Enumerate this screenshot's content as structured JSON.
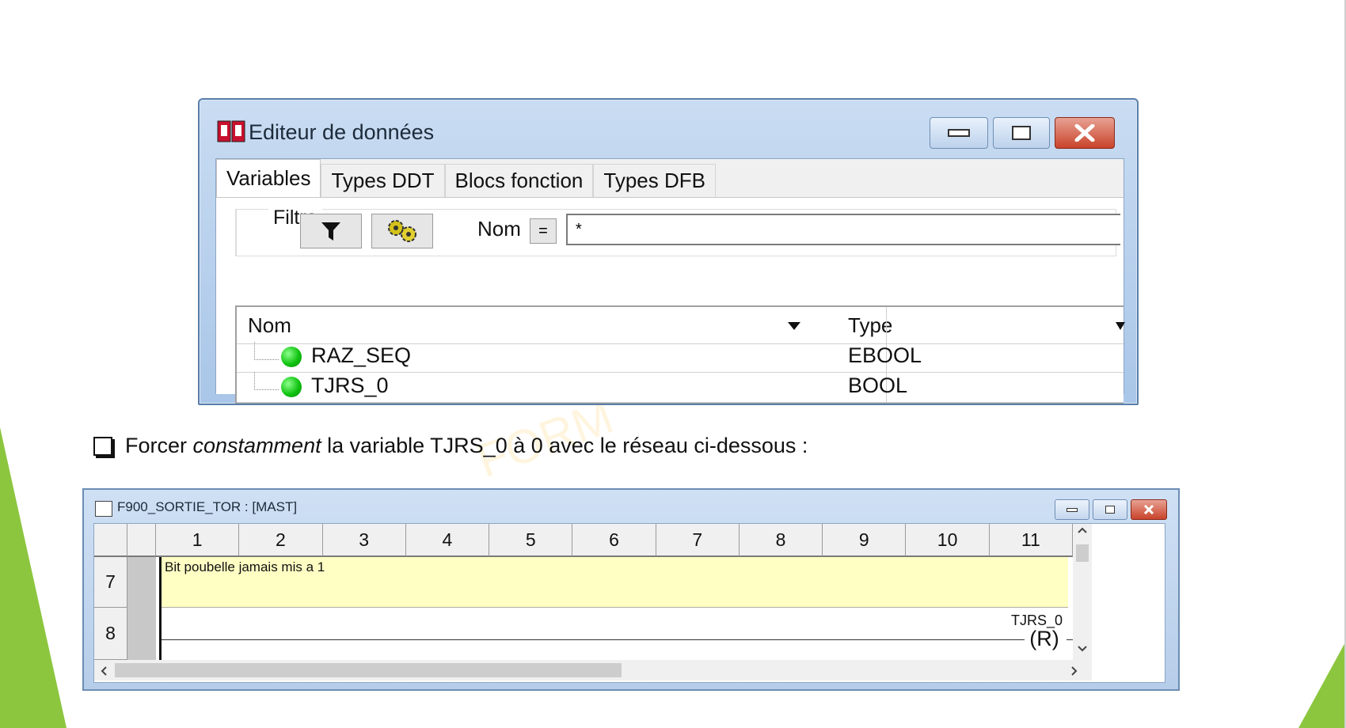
{
  "data_editor": {
    "title": "Editeur de données",
    "tabs": [
      "Variables",
      "Types DDT",
      "Blocs fonction",
      "Types DFB"
    ],
    "active_tab": "Variables",
    "filter": {
      "legend": "Filtre",
      "field_label": "Nom",
      "operator": "=",
      "value": "*"
    },
    "columns": {
      "name": "Nom",
      "type": "Type"
    },
    "rows": [
      {
        "name": "RAZ_SEQ",
        "type": "EBOOL"
      },
      {
        "name": "TJRS_0",
        "type": "BOOL"
      }
    ]
  },
  "instruction": {
    "prefix": "Forcer ",
    "emphasis": "constamment",
    "suffix": " la variable TJRS_0 à 0 avec le réseau ci-dessous :"
  },
  "ladder_window": {
    "title": "F900_SORTIE_TOR : [MAST]",
    "columns": [
      "1",
      "2",
      "3",
      "4",
      "5",
      "6",
      "7",
      "8",
      "9",
      "10",
      "11"
    ],
    "rows": [
      {
        "number": "7",
        "comment": "Bit poubelle jamais mis a 1"
      },
      {
        "number": "8",
        "coil_variable": "TJRS_0",
        "coil_symbol": "R"
      }
    ]
  },
  "colors": {
    "green_accent": "#8cc63f",
    "comment_bg": "#ffffc4",
    "window_blue": "#b6cde9"
  }
}
